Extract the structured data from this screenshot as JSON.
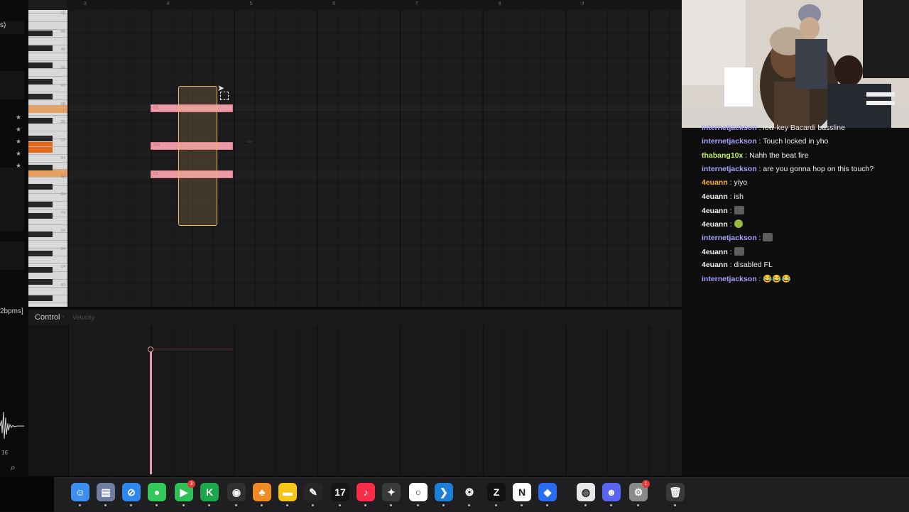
{
  "left_strip": {
    "bpm_text": "2bpms]",
    "wave_number": "16",
    "search_icon": "magnifier"
  },
  "ruler": {
    "bars": [
      "3",
      "4",
      "5",
      "6",
      "7",
      "8",
      "9"
    ]
  },
  "keyboard": {
    "labels": [
      "C6",
      "B5",
      "A5",
      "G5",
      "F5",
      "E5",
      "D5",
      "C5",
      "B4",
      "A4",
      "G4",
      "F4",
      "E4",
      "D4",
      "C4",
      "B3"
    ]
  },
  "notes": [
    {
      "label": "G5"
    },
    {
      "label": "D#5"
    },
    {
      "label": "C5"
    }
  ],
  "control": {
    "label": "Control",
    "arrow": "›",
    "parameter": "Velocity"
  },
  "chat": {
    "messages": [
      {
        "user": "internetjackson",
        "color": "#a8a0ff",
        "text": " : low-key Bacardi bassline"
      },
      {
        "user": "internetjackson",
        "color": "#a8a0ff",
        "text": " : Touch locked in yho"
      },
      {
        "user": "thabang10x",
        "color": "#c4f06a",
        "text": " : Nahh the beat fire"
      },
      {
        "user": "internetjackson",
        "color": "#a8a0ff",
        "text": " : are you gonna hop on this touch?"
      },
      {
        "user": "4euann",
        "color": "#ffb03b",
        "text": " : yiyo"
      },
      {
        "user": "4euann",
        "color": "#efefef",
        "text": " : ish"
      },
      {
        "user": "4euann",
        "color": "#efefef",
        "text": " : ",
        "emote": "grey"
      },
      {
        "user": "4euann",
        "color": "#efefef",
        "text": " : ",
        "emote": "green"
      },
      {
        "user": "internetjackson",
        "color": "#a8a0ff",
        "text": " : ",
        "emote": "grey"
      },
      {
        "user": "4euann",
        "color": "#efefef",
        "text": " : ",
        "emote": "grey"
      },
      {
        "user": "4euann",
        "color": "#efefef",
        "text": " : disabled FL"
      },
      {
        "user": "internetjackson",
        "color": "#a8a0ff",
        "text": " : 😂😂😂"
      }
    ]
  },
  "dock": {
    "apps": [
      {
        "name": "finder",
        "color": "#3c8ef0",
        "glyph": "☺"
      },
      {
        "name": "preview",
        "color": "#6e7ea0",
        "glyph": "▤"
      },
      {
        "name": "safari",
        "color": "#2f86ec",
        "glyph": "⊘"
      },
      {
        "name": "messages",
        "color": "#34c759",
        "glyph": "●"
      },
      {
        "name": "facetime",
        "color": "#2fbf57",
        "glyph": "▶",
        "badge": "3"
      },
      {
        "name": "kite",
        "color": "#1aa84a",
        "glyph": "K"
      },
      {
        "name": "obs",
        "color": "#303030",
        "glyph": "◉"
      },
      {
        "name": "fl-studio",
        "color": "#f08a24",
        "glyph": "♣"
      },
      {
        "name": "notes",
        "color": "#f5c518",
        "glyph": "▬"
      },
      {
        "name": "pen",
        "color": "#262626",
        "glyph": "✎"
      },
      {
        "name": "tradingview",
        "color": "#151515",
        "glyph": "17"
      },
      {
        "name": "music",
        "color": "#fa2d48",
        "glyph": "♪"
      },
      {
        "name": "davinci",
        "color": "#3a3a3a",
        "glyph": "✦"
      },
      {
        "name": "github",
        "color": "#ffffff",
        "glyph": "○"
      },
      {
        "name": "vscode",
        "color": "#1e7fd6",
        "glyph": "❯"
      },
      {
        "name": "chatgpt",
        "color": "#1f1f1f",
        "glyph": "❂"
      },
      {
        "name": "capcut",
        "color": "#111111",
        "glyph": "Z"
      },
      {
        "name": "notion",
        "color": "#ffffff",
        "glyph": "N"
      },
      {
        "name": "roblox",
        "color": "#2a6cf0",
        "glyph": "◆"
      },
      {
        "name": "chrome",
        "color": "#e8e8e8",
        "glyph": "◍"
      },
      {
        "name": "discord",
        "color": "#5865f2",
        "glyph": "☻"
      },
      {
        "name": "settings",
        "color": "#8a8a8a",
        "glyph": "⚙",
        "badge": "1"
      },
      {
        "name": "trash",
        "color": "#3a3a3a",
        "glyph": "🗑"
      }
    ]
  }
}
